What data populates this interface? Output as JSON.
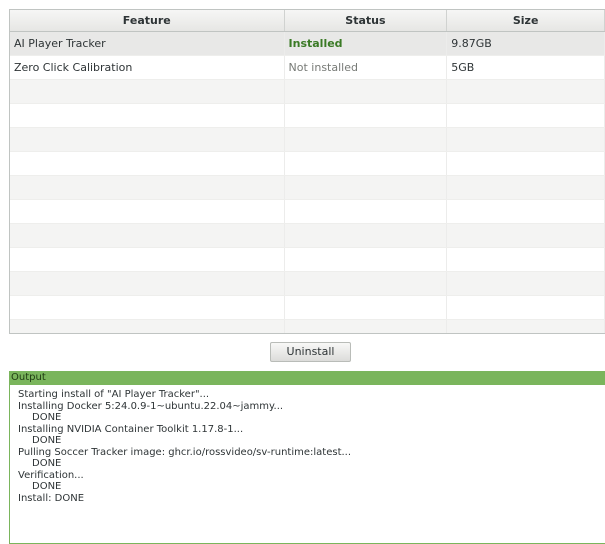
{
  "table": {
    "columns": [
      "Feature",
      "Status",
      "Size"
    ],
    "rows": [
      {
        "feature": "AI Player Tracker",
        "status": "Installed",
        "size": "9.87GB"
      },
      {
        "feature": "Zero Click Calibration",
        "status": "Not installed",
        "size": "5GB"
      }
    ]
  },
  "uninstall_button": {
    "label": "Uninstall"
  },
  "output": {
    "label": "Output",
    "lines": [
      "Starting install of \"AI Player Tracker\"...",
      "Installing Docker 5:24.0.9-1~ubuntu.22.04~jammy...",
      "DONE",
      "Installing NVIDIA Container Toolkit 1.17.8-1...",
      "DONE",
      "Pulling Soccer Tracker image: ghcr.io/rossvideo/sv-runtime:latest...",
      "DONE",
      "Verification...",
      "DONE",
      "Install: DONE"
    ]
  },
  "colors": {
    "installed": "#3a7a25",
    "not_installed": "#777a76",
    "output_accent": "#7ab55c"
  }
}
